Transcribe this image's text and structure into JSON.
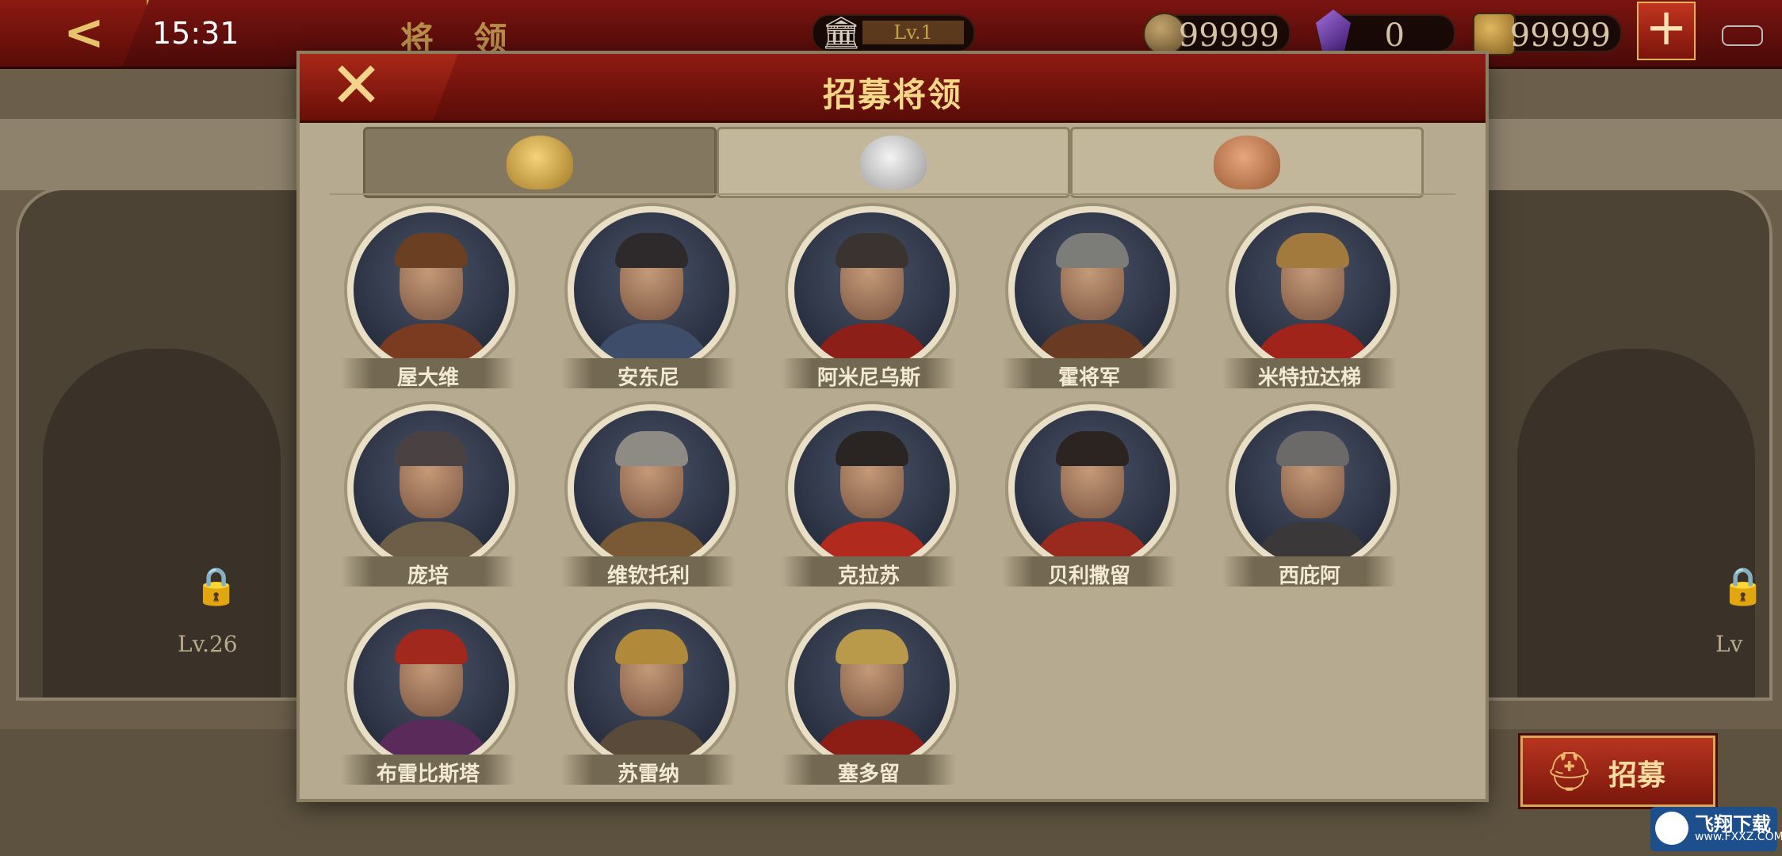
{
  "status": {
    "time": "15:31"
  },
  "header": {
    "title": "将 领",
    "level": "Lv.1",
    "currencies": [
      {
        "name": "gold-coins",
        "value": "99999"
      },
      {
        "name": "gems",
        "value": "0"
      },
      {
        "name": "spqr-tokens",
        "value": "99999"
      }
    ]
  },
  "background": {
    "left_lock_level": "Lv.26",
    "right_lock_level": "Lv"
  },
  "dialog": {
    "title": "招募将领",
    "tabs": [
      {
        "tier": "gold",
        "icon": "gold-helmet-emblem"
      },
      {
        "tier": "silver",
        "icon": "silver-helmet-emblem"
      },
      {
        "tier": "bronze",
        "icon": "bronze-helmet-emblem"
      }
    ],
    "generals": [
      {
        "name": "屋大维",
        "hair": "#6b4022",
        "armor": "#7a3b20"
      },
      {
        "name": "安东尼",
        "hair": "#2e2a2c",
        "armor": "#3e4e6a"
      },
      {
        "name": "阿米尼乌斯",
        "hair": "#3b3330",
        "armor": "#8c2018"
      },
      {
        "name": "霍将军",
        "hair": "#7c7c78",
        "armor": "#6b3a22"
      },
      {
        "name": "米特拉达梯",
        "hair": "#a37a3e",
        "armor": "#a0241a"
      },
      {
        "name": "庞培",
        "hair": "#4a4242",
        "armor": "#6e5e48"
      },
      {
        "name": "维钦托利",
        "hair": "#8e8a84",
        "armor": "#7a5a34"
      },
      {
        "name": "克拉苏",
        "hair": "#2a2422",
        "armor": "#b02a1e"
      },
      {
        "name": "贝利撒留",
        "hair": "#2c2420",
        "armor": "#9a2a1e"
      },
      {
        "name": "西庇阿",
        "hair": "#6c6a68",
        "armor": "#3a3838"
      },
      {
        "name": "布雷比斯塔",
        "hair": "#a0281c",
        "armor": "#5a2a5a"
      },
      {
        "name": "苏雷纳",
        "hair": "#b08a3a",
        "armor": "#5a4a3a"
      },
      {
        "name": "塞多留",
        "hair": "#b89a4a",
        "armor": "#8c1e16"
      }
    ]
  },
  "recruit_button": {
    "label": "招募"
  },
  "watermark": {
    "line1": "飞翔下载",
    "line2": "www.FXXZ.COM"
  }
}
